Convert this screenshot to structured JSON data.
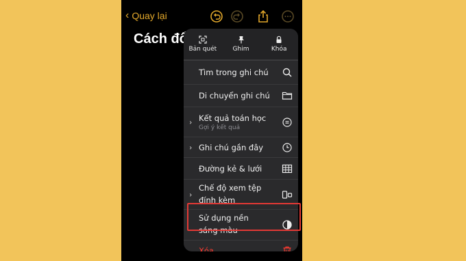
{
  "header": {
    "back_label": "Quay lại",
    "note_title": "Cách đổ"
  },
  "quick_actions": [
    {
      "label": "Bản quét",
      "icon": "scan-icon"
    },
    {
      "label": "Ghim",
      "icon": "pin-icon"
    },
    {
      "label": "Khóa",
      "icon": "lock-icon"
    }
  ],
  "menu_items": [
    {
      "label": "Tìm trong ghi chú",
      "icon": "search-icon"
    },
    {
      "label": "Di chuyển ghi chú",
      "icon": "folder-icon"
    },
    {
      "label": "Kết quả toán học",
      "sublabel": "Gợi ý kết quả",
      "icon": "equals-circle-icon",
      "submenu": true
    },
    {
      "label": "Ghi chú gần đây",
      "icon": "clock-icon",
      "submenu": true
    },
    {
      "label": "Đường kẻ & lưới",
      "icon": "grid-icon"
    },
    {
      "label_line1": "Chế độ xem tệp",
      "label_line2": "đính kèm",
      "icon": "attachments-view-icon",
      "submenu": true
    },
    {
      "label_line1": "Sử dụng nền",
      "label_line2": "sáng màu",
      "icon": "contrast-icon",
      "highlighted": true
    },
    {
      "label": "Xóa",
      "icon": "trash-icon",
      "destructive": true
    }
  ],
  "colors": {
    "background": "#F2C45A",
    "accent": "#E3A82B",
    "destructive": "#FF3B30",
    "highlight_border": "#E53935"
  }
}
